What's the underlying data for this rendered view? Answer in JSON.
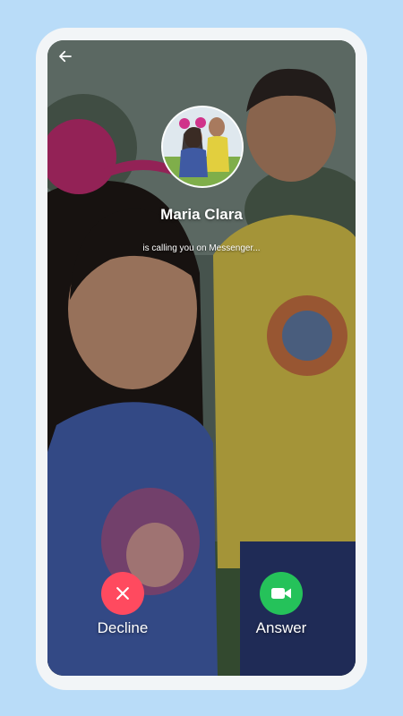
{
  "header": {
    "back_icon": "arrow-left-icon"
  },
  "caller": {
    "name": "Maria Clara",
    "status": "is calling you on Messenger..."
  },
  "actions": {
    "decline": {
      "label": "Decline",
      "icon": "close-icon",
      "color": "#ff4a5f"
    },
    "answer": {
      "label": "Answer",
      "icon": "video-camera-icon",
      "color": "#25c25a"
    }
  },
  "colors": {
    "page_background": "#b9dcf8",
    "phone_frame": "#f2f5f7",
    "text": "#ffffff"
  }
}
